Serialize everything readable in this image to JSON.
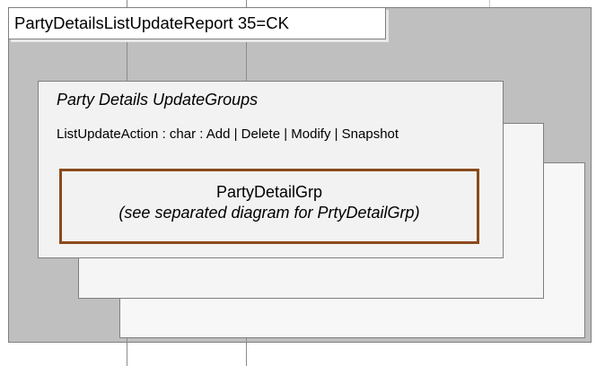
{
  "message": {
    "title": "PartyDetailsListUpdateReport  35=CK"
  },
  "update_groups": {
    "title": "Party Details UpdateGroups",
    "field": "ListUpdateAction : char : Add | Delete | Modify | Snapshot"
  },
  "component": {
    "name": "PartyDetailGrp",
    "note": "(see separated diagram for PrtyDetailGrp)"
  },
  "colors": {
    "background": "#bfbfbf",
    "card": "#f2f2f2",
    "component_border": "#8b4a1c",
    "outline": "#7f7f7f"
  }
}
